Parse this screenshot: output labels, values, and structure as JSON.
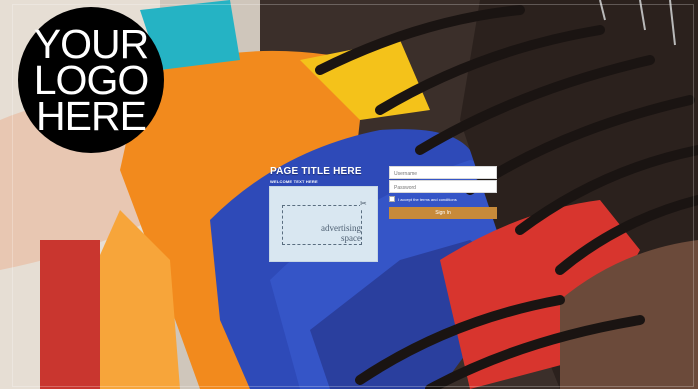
{
  "logo": {
    "lines": [
      "YOUR",
      "LOGO",
      "HERE"
    ]
  },
  "page": {
    "title": "PAGE TITLE HERE",
    "welcome": "WELCOME TEXT HERE"
  },
  "ad": {
    "line1": "advertising",
    "line2": "space",
    "scissors_icon": "scissors-icon"
  },
  "login": {
    "username_placeholder": "Username",
    "password_placeholder": "Password",
    "terms_label": "I accept the terms and conditions",
    "signin_label": "Sign In"
  },
  "colors": {
    "logo_bg": "#000000",
    "ad_bg": "#d9e7f1",
    "signin_bg": "#c78a3a"
  }
}
